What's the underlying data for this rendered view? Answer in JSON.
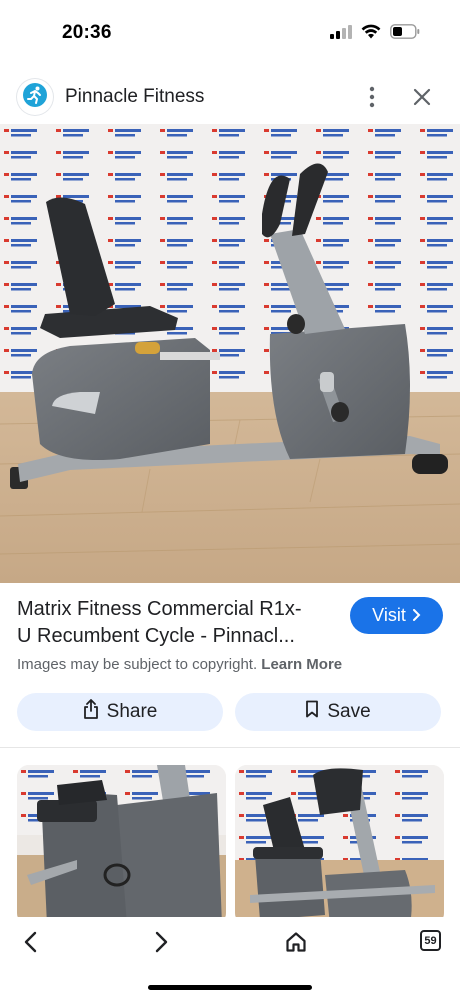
{
  "status_bar": {
    "time": "20:36"
  },
  "header": {
    "site_name": "Pinnacle Fitness",
    "logo_icon": "runner-icon",
    "accent": "#1fa3d8"
  },
  "main_image": {
    "description_icon": "recumbent-bike-photo",
    "watermark_text": "PINNACLE FITNESS"
  },
  "result": {
    "title_line1": "Matrix Fitness Commercial R1x-",
    "title_line2": "U Recumbent Cycle - Pinnacl...",
    "visit_label": "Visit",
    "copyright_text": "Images may be subject to copyright.",
    "learn_more": "Learn More"
  },
  "actions": {
    "share_label": "Share",
    "save_label": "Save"
  },
  "bottom_nav": {
    "tab_count": "59"
  },
  "colors": {
    "visit_blue": "#1a73e8",
    "pill_bg": "#e8f0fe"
  }
}
